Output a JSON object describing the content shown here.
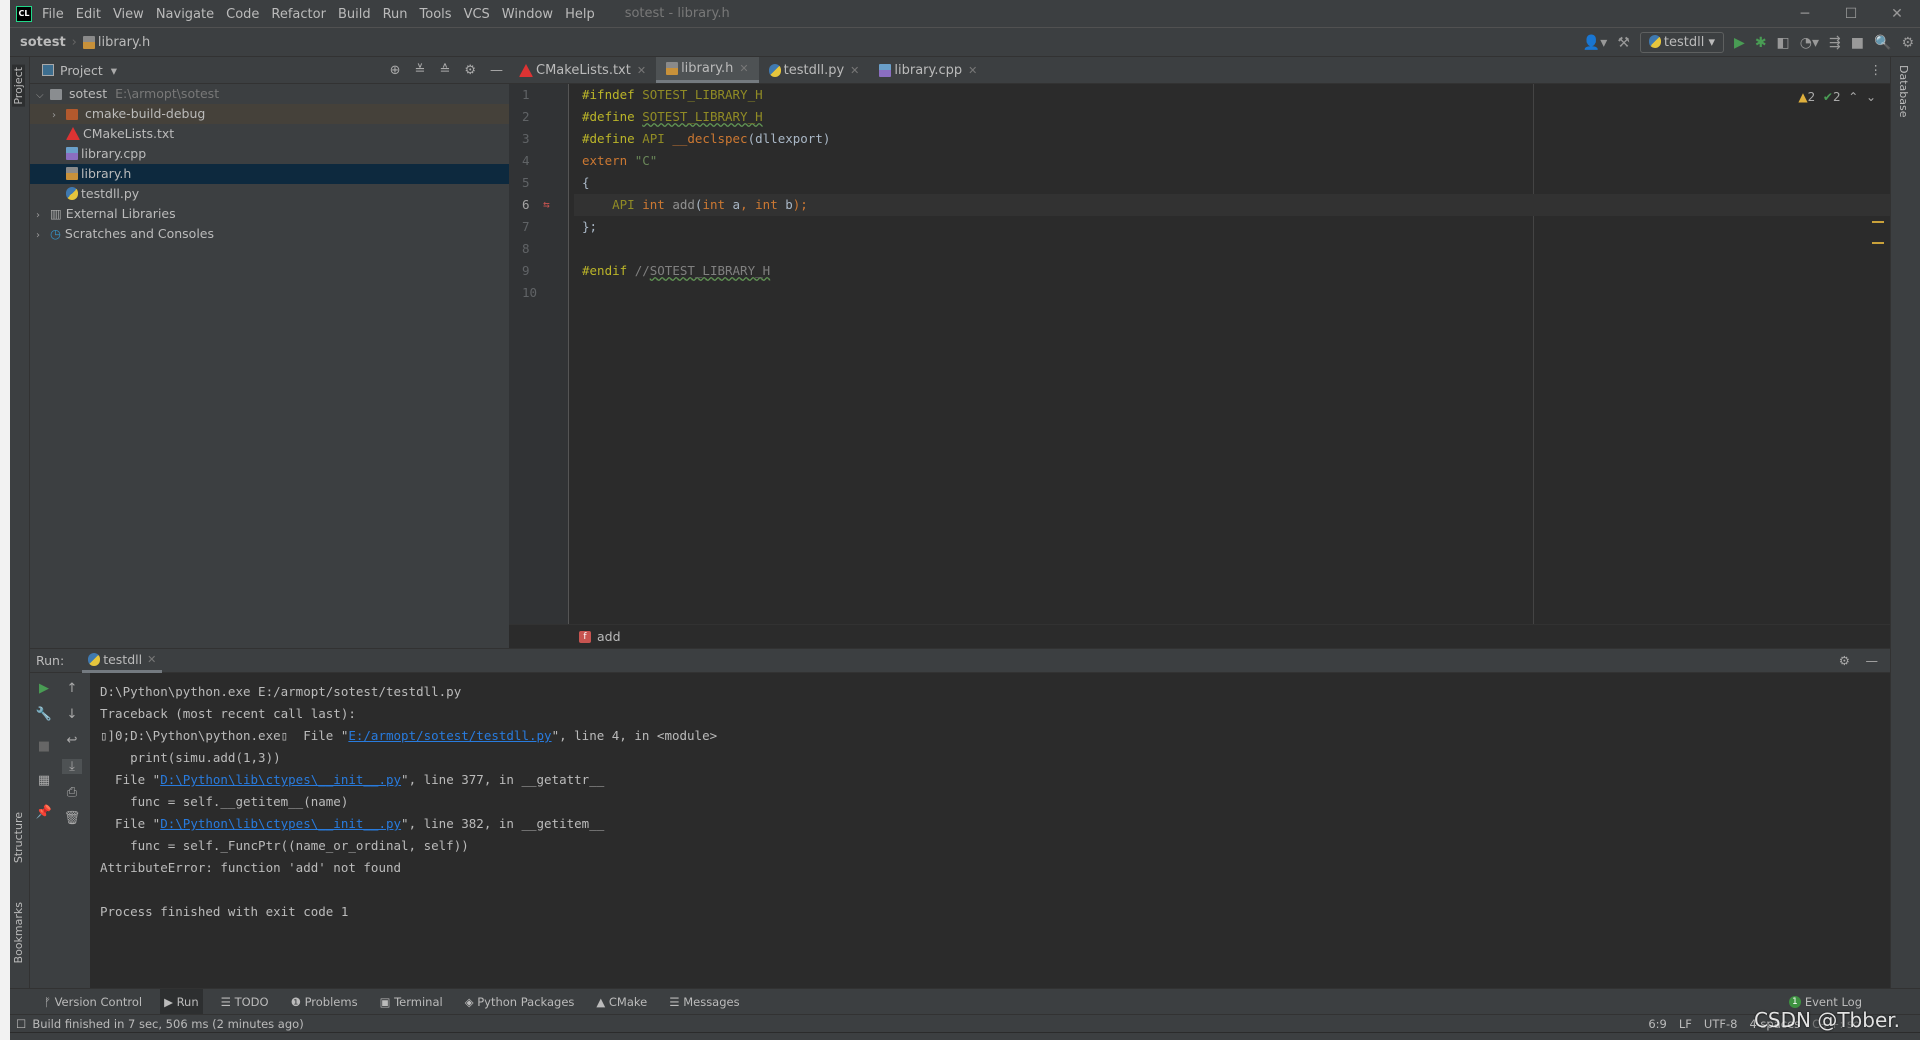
{
  "window": {
    "title": "sotest - library.h",
    "logo": "CL",
    "menu": [
      "File",
      "Edit",
      "View",
      "Navigate",
      "Code",
      "Refactor",
      "Build",
      "Run",
      "Tools",
      "VCS",
      "Window",
      "Help"
    ]
  },
  "nav": {
    "project": "sotest",
    "file": "library.h",
    "run_config": "testdll"
  },
  "left_stripe": {
    "project": "Project",
    "structure": "Structure",
    "bookmarks": "Bookmarks"
  },
  "right_stripe": {
    "database": "Database"
  },
  "project_panel": {
    "title": "Project",
    "tree": [
      {
        "label": "sotest",
        "path": "E:\\armopt\\sotest"
      },
      {
        "label": "cmake-build-debug"
      },
      {
        "label": "CMakeLists.txt"
      },
      {
        "label": "library.cpp"
      },
      {
        "label": "library.h"
      },
      {
        "label": "testdll.py"
      },
      {
        "label": "External Libraries"
      },
      {
        "label": "Scratches and Consoles"
      }
    ]
  },
  "editor": {
    "tabs": [
      "CMakeLists.txt",
      "library.h",
      "testdll.py",
      "library.cpp"
    ],
    "active_tab": "library.h",
    "line_numbers": [
      "1",
      "2",
      "3",
      "4",
      "5",
      "6",
      "7",
      "8",
      "9",
      "10"
    ],
    "code": {
      "l1a": "#ifndef ",
      "l1b": "SOTEST_LIBRARY_H",
      "l2a": "#define ",
      "l2b": "SOTEST_LIBRARY_H",
      "l3a": "#define ",
      "l3b": "API ",
      "l3c": "__declspec",
      "l3d": "(dllexport)",
      "l4a": "extern ",
      "l4b": "\"C\"",
      "l5": "{",
      "l6a": "    API ",
      "l6b": "int ",
      "l6c": "add",
      "l6d": "(",
      "l6e": "int ",
      "l6f": "a",
      "l6g": ", ",
      "l6h": "int ",
      "l6i": "b",
      "l6j": ");",
      "l7": "};",
      "l9a": "#endif ",
      "l9b": "//",
      "l9c": "SOTEST_LIBRARY_H"
    },
    "warnings": "2",
    "typos": "2",
    "breadcrumb": "add"
  },
  "run": {
    "label": "Run:",
    "tab": "testdll",
    "output": {
      "o1": "D:\\Python\\python.exe E:/armopt/sotest/testdll.py",
      "o2": "Traceback (most recent call last):",
      "o3a": "▯]0;D:\\Python\\python.exe▯  File \"",
      "o3b": "E:/armopt/sotest/testdll.py",
      "o3c": "\", line 4, in <module>",
      "o4": "    print(simu.add(1,3))",
      "o5a": "  File \"",
      "o5b": "D:\\Python\\lib\\ctypes\\__init__.py",
      "o5c": "\", line 377, in __getattr__",
      "o6": "    func = self.__getitem__(name)",
      "o7a": "  File \"",
      "o7b": "D:\\Python\\lib\\ctypes\\__init__.py",
      "o7c": "\", line 382, in __getitem__",
      "o8": "    func = self._FuncPtr((name_or_ordinal, self))",
      "o9": "AttributeError: function 'add' not found",
      "o11": "Process finished with exit code 1"
    }
  },
  "bottom_tools": [
    "Version Control",
    "Run",
    "TODO",
    "Problems",
    "Terminal",
    "Python Packages",
    "CMake",
    "Messages"
  ],
  "event_log": {
    "count": "1",
    "label": "Event Log"
  },
  "status": {
    "message": "Build finished in 7 sec, 506 ms (2 minutes ago)",
    "position": "6:9",
    "line_sep": "LF",
    "encoding": "UTF-8",
    "indent": "4 spaces",
    "context": "C++: so"
  },
  "watermark": "CSDN @Tbber."
}
